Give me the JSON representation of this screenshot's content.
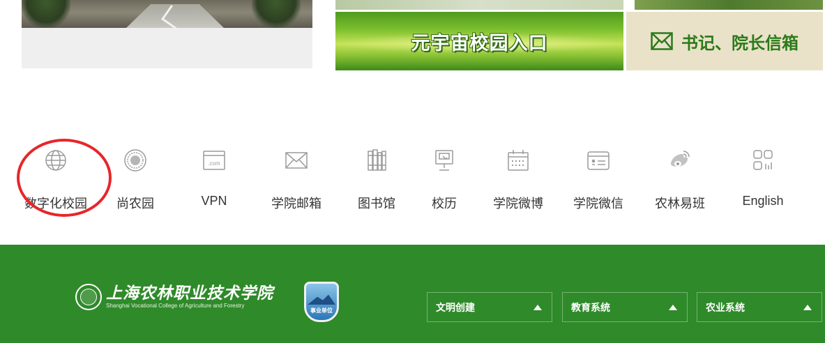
{
  "banners": {
    "metaverse_label": "元宇宙校园入口",
    "mailbox_label": "书记、院长信箱"
  },
  "quick_links": [
    {
      "label": "数字化校园",
      "icon": "globe-icon"
    },
    {
      "label": "尚农园",
      "icon": "seal-icon"
    },
    {
      "label": "VPN",
      "icon": "vpn-icon"
    },
    {
      "label": "学院邮箱",
      "icon": "mail-icon"
    },
    {
      "label": "图书馆",
      "icon": "library-icon"
    },
    {
      "label": "校历",
      "icon": "calendar-screen-icon"
    },
    {
      "label": "学院微博",
      "icon": "calendar-icon"
    },
    {
      "label": "学院微信",
      "icon": "id-card-icon"
    },
    {
      "label": "农林易班",
      "icon": "weibo-icon"
    },
    {
      "label": "English",
      "icon": "grid-icon"
    }
  ],
  "footer": {
    "logo_cn": "上海农林职业技术学院",
    "logo_en": "Shanghai Vocational College of Agriculture and Forestry",
    "badge_label": "事业单位",
    "dropdowns": [
      {
        "label": "文明创建"
      },
      {
        "label": "教育系统"
      },
      {
        "label": "农业系统"
      }
    ]
  },
  "colors": {
    "footer_green": "#2f8a2a",
    "highlight_red": "#e8262b",
    "mailbox_text": "#2b7a1a",
    "icon_grey": "#9a9a9a"
  }
}
